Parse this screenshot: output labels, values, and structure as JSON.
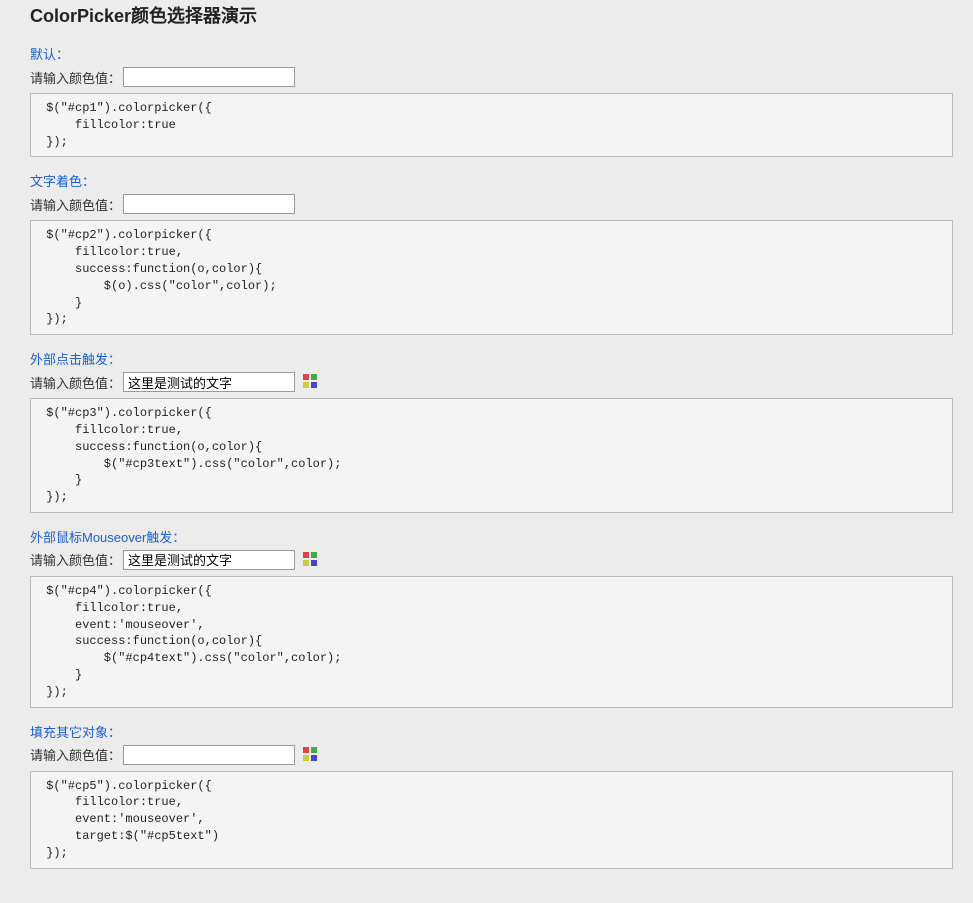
{
  "page_title": "ColorPicker颜色选择器演示",
  "sections": [
    {
      "title": "默认：",
      "input_label": "请输入颜色值：",
      "input_value": "",
      "has_swatch": false,
      "code": " $(\"#cp1\").colorpicker({\n     fillcolor:true\n });"
    },
    {
      "title": "文字着色：",
      "input_label": "请输入颜色值：",
      "input_value": "",
      "has_swatch": false,
      "code": " $(\"#cp2\").colorpicker({\n     fillcolor:true,\n     success:function(o,color){\n         $(o).css(\"color\",color);\n     }\n });"
    },
    {
      "title": "外部点击触发：",
      "input_label": "请输入颜色值：",
      "input_value": "这里是测试的文字",
      "has_swatch": true,
      "code": " $(\"#cp3\").colorpicker({\n     fillcolor:true,\n     success:function(o,color){\n         $(\"#cp3text\").css(\"color\",color);\n     }\n });"
    },
    {
      "title": "外部鼠标Mouseover触发：",
      "input_label": "请输入颜色值：",
      "input_value": "这里是测试的文字",
      "has_swatch": true,
      "code": " $(\"#cp4\").colorpicker({\n     fillcolor:true,\n     event:'mouseover',\n     success:function(o,color){\n         $(\"#cp4text\").css(\"color\",color);\n     }\n });"
    },
    {
      "title": "填充其它对象：",
      "input_label": "请输入颜色值：",
      "input_value": "",
      "has_swatch": true,
      "code": " $(\"#cp5\").colorpicker({\n     fillcolor:true,\n     event:'mouseover',\n     target:$(\"#cp5text\")\n });"
    }
  ]
}
